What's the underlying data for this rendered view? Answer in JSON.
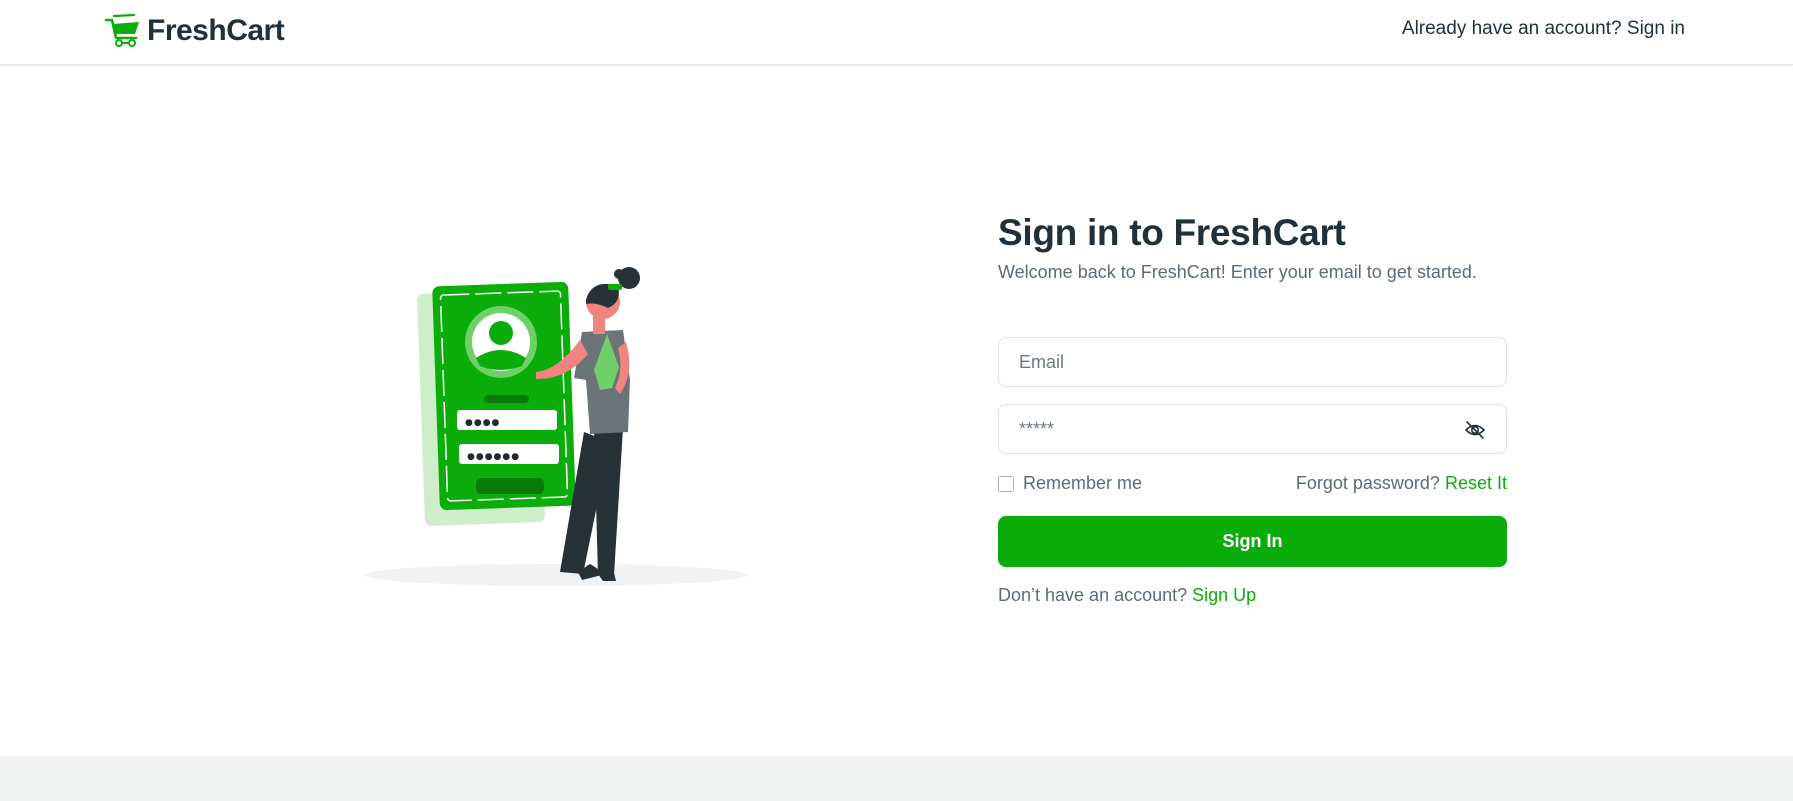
{
  "brand": {
    "name": "FreshCart",
    "logo_icon": "shopping-cart-icon",
    "accent": "#0aad0a"
  },
  "header": {
    "prompt": "Already have an account?",
    "link": "Sign in"
  },
  "illustration": {
    "mask_short": "●●●●",
    "mask_long": "●●●●●●"
  },
  "form": {
    "title": "Sign in to FreshCart",
    "subtitle": "Welcome back to FreshCart! Enter your email to get started.",
    "email_placeholder": "Email",
    "password_placeholder": "*****",
    "toggle_icon": "eye-off-icon",
    "remember_label": "Remember me",
    "forgot_prompt": "Forgot password?",
    "reset_link": "Reset It",
    "submit_label": "Sign In",
    "signup_prompt": "Don’t have an account?",
    "signup_link": "Sign Up"
  },
  "colors": {
    "primary": "#0aad0a",
    "text_dark": "#21313c",
    "text_muted": "#5c6c75",
    "footer_bg": "#f0f2f1"
  }
}
